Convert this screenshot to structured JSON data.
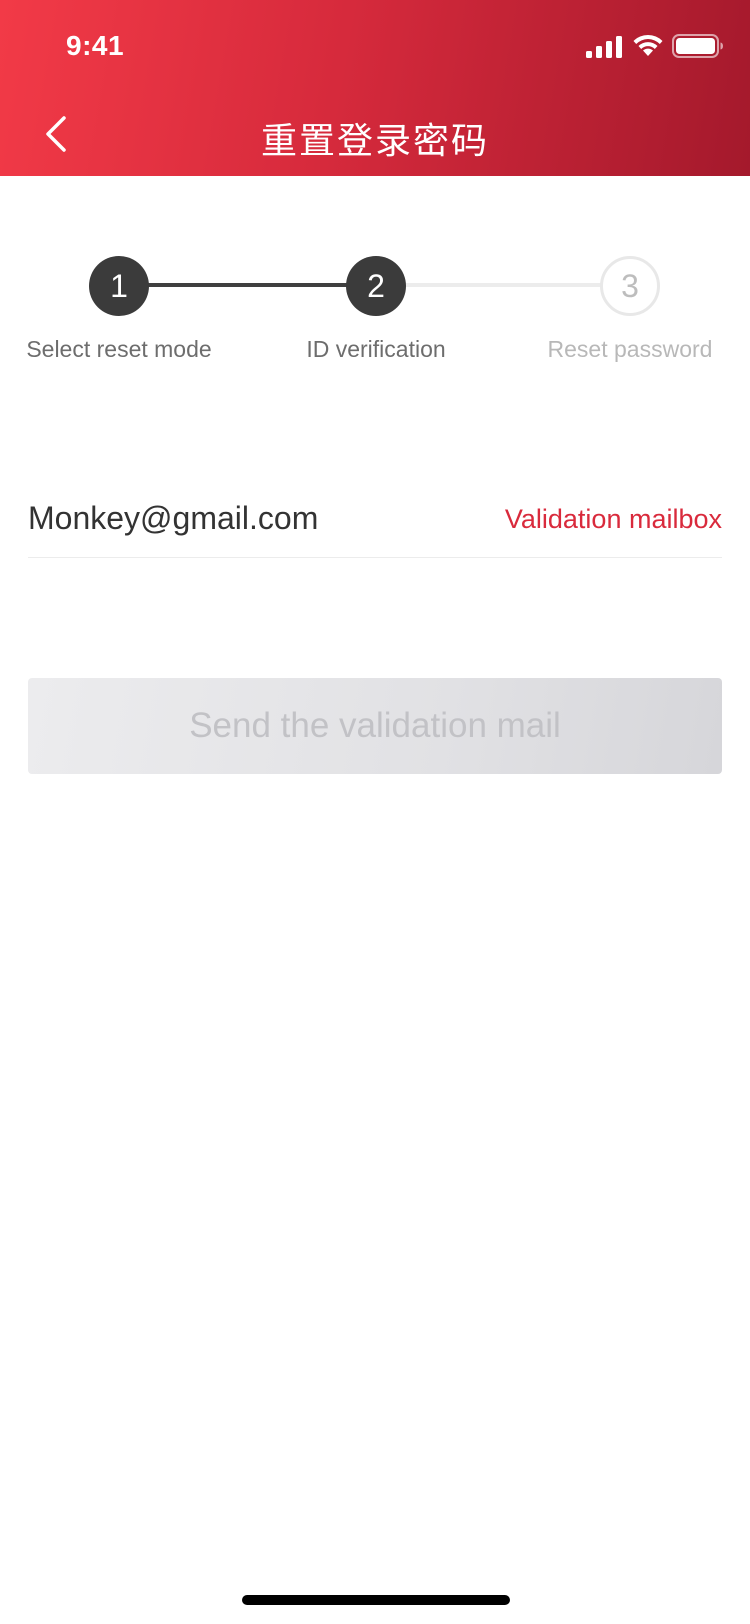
{
  "status_bar": {
    "time": "9:41",
    "icons": [
      "signal-icon",
      "wifi-icon",
      "battery-icon"
    ]
  },
  "nav": {
    "back_icon": "chevron-left-icon",
    "title": "重置登录密码"
  },
  "stepper": {
    "steps": [
      {
        "number": "1",
        "label": "Select reset mode",
        "state": "completed"
      },
      {
        "number": "2",
        "label": "ID verification",
        "state": "active"
      },
      {
        "number": "3",
        "label": "Reset password",
        "state": "pending"
      }
    ]
  },
  "email": {
    "value": "Monkey@gmail.com",
    "action_label": "Validation mailbox"
  },
  "send_button": {
    "label": "Send the validation mail",
    "enabled": false
  },
  "colors": {
    "header_start": "#f23a47",
    "header_end": "#a4192c",
    "accent": "#d92a3c",
    "step_active": "#3b3b3b",
    "step_inactive": "#bdbdbd"
  }
}
